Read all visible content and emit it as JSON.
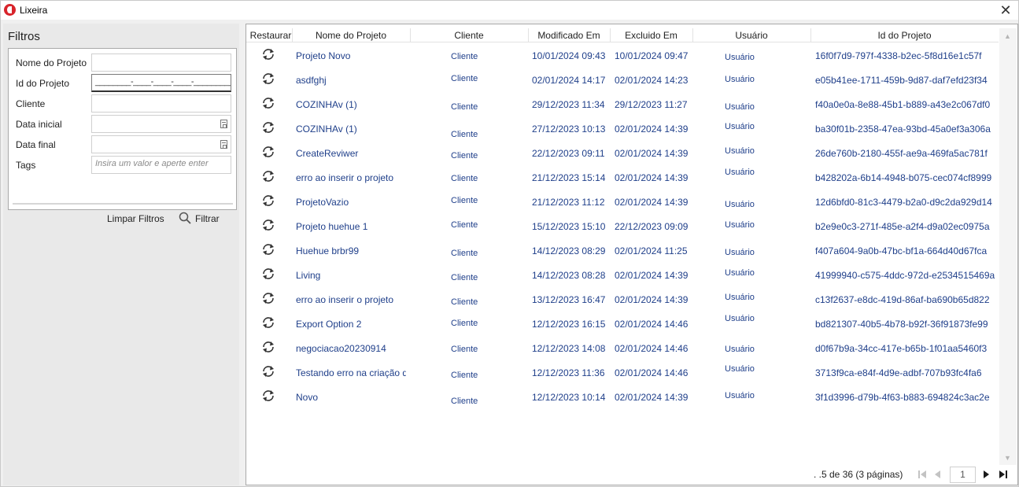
{
  "window": {
    "title": "Lixeira",
    "close_glyph": "✕"
  },
  "filters": {
    "heading": "Filtros",
    "fields": [
      {
        "label": "Nome do Projeto",
        "value": "",
        "placeholder": ""
      },
      {
        "label": "Id do Projeto",
        "value": "________-____-____-____-____________",
        "placeholder": ""
      },
      {
        "label": "Cliente",
        "value": "",
        "placeholder": ""
      },
      {
        "label": "Data inicial",
        "value": "",
        "placeholder": ""
      },
      {
        "label": "Data final",
        "value": "",
        "placeholder": ""
      },
      {
        "label": "Tags",
        "value": "",
        "placeholder": "Insira um valor e aperte enter"
      }
    ],
    "clear_label": "Limpar Filtros",
    "filter_label": "Filtrar"
  },
  "grid": {
    "columns": [
      "Restaurar",
      "Nome do Projeto",
      "Cliente",
      "Modificado Em",
      "Excluido Em",
      "Usuário",
      "Id do Projeto"
    ],
    "rows": [
      {
        "name": "Projeto Novo",
        "client": "Cliente",
        "modified": "10/01/2024 09:43",
        "deleted": "10/01/2024 09:47",
        "user": "Usuário",
        "id": "16f0f7d9-797f-4338-b2ec-5f8d16e1c57f"
      },
      {
        "name": "asdfghj",
        "client": "Cliente",
        "modified": "02/01/2024 14:17",
        "deleted": "02/01/2024 14:23",
        "user": "Usuário",
        "id": "e05b41ee-1711-459b-9d87-daf7efd23f34"
      },
      {
        "name": "COZINHAv (1)",
        "client": "Cliente",
        "modified": "29/12/2023 11:34",
        "deleted": "29/12/2023 11:27",
        "user": "Usuário",
        "id": "f40a0e0a-8e88-45b1-b889-a43e2c067df0"
      },
      {
        "name": "COZINHAv (1)",
        "client": "Cliente",
        "modified": "27/12/2023 10:13",
        "deleted": "02/01/2024 14:39",
        "user": "Usuário",
        "id": "ba30f01b-2358-47ea-93bd-45a0ef3a306a"
      },
      {
        "name": "CreateReviwer",
        "client": "Cliente",
        "modified": "22/12/2023 09:11",
        "deleted": "02/01/2024 14:39",
        "user": "Usuário",
        "id": "26de760b-2180-455f-ae9a-469fa5ac781f"
      },
      {
        "name": "erro ao inserir o projeto",
        "client": "Cliente",
        "modified": "21/12/2023 15:14",
        "deleted": "02/01/2024 14:39",
        "user": "Usuário",
        "id": "b428202a-6b14-4948-b075-cec074cf8999"
      },
      {
        "name": "ProjetoVazio",
        "client": "Cliente",
        "modified": "21/12/2023 11:12",
        "deleted": "02/01/2024 14:39",
        "user": "Usuário",
        "id": "12d6bfd0-81c3-4479-b2a0-d9c2da929d14"
      },
      {
        "name": "Projeto huehue 1",
        "client": "Cliente",
        "modified": "15/12/2023 15:10",
        "deleted": "22/12/2023 09:09",
        "user": "Usuário",
        "id": "b2e9e0c3-271f-485e-a2f4-d9a02ec0975a"
      },
      {
        "name": "Huehue brbr99",
        "client": "Cliente",
        "modified": "14/12/2023 08:29",
        "deleted": "02/01/2024 11:25",
        "user": "Usuário",
        "id": "f407a604-9a0b-47bc-bf1a-664d40d67fca"
      },
      {
        "name": "Living",
        "client": "Cliente",
        "modified": "14/12/2023 08:28",
        "deleted": "02/01/2024 14:39",
        "user": "Usuário",
        "id": "41999940-c575-4ddc-972d-e2534515469a"
      },
      {
        "name": "erro ao inserir o projeto",
        "client": "Cliente",
        "modified": "13/12/2023 16:47",
        "deleted": "02/01/2024 14:39",
        "user": "Usuário",
        "id": "c13f2637-e8dc-419d-86af-ba690b65d822"
      },
      {
        "name": "Export Option 2",
        "client": "Cliente",
        "modified": "12/12/2023 16:15",
        "deleted": "02/01/2024 14:46",
        "user": "Usuário",
        "id": "bd821307-40b5-4b78-b92f-36f91873fe99"
      },
      {
        "name": "negociacao20230914",
        "client": "Cliente",
        "modified": "12/12/2023 14:08",
        "deleted": "02/01/2024 14:46",
        "user": "Usuário",
        "id": "d0f67b9a-34cc-417e-b65b-1f01aa5460f3"
      },
      {
        "name": "Testando erro na criação d",
        "client": "Cliente",
        "modified": "12/12/2023 11:36",
        "deleted": "02/01/2024 14:46",
        "user": "Usuário",
        "id": "3713f9ca-e84f-4d9e-adbf-707b93fc4fa6"
      },
      {
        "name": "Novo",
        "client": "Cliente",
        "modified": "12/12/2023 10:14",
        "deleted": "02/01/2024 14:39",
        "user": "Usuário",
        "id": "3f1d3996-d79b-4f63-b883-694824c3ac2e"
      }
    ]
  },
  "pager": {
    "info": ". .5 de 36 (3 páginas)",
    "page": "1"
  },
  "colors": {
    "link": "#1f3f8a",
    "app_icon": "#d8242b"
  },
  "icons": [
    "app-logo-icon",
    "close-icon",
    "calendar-icon",
    "search-icon",
    "restore-icon",
    "first-page-icon",
    "prev-page-icon",
    "next-page-icon",
    "last-page-icon",
    "scroll-up-icon",
    "scroll-down-icon"
  ]
}
